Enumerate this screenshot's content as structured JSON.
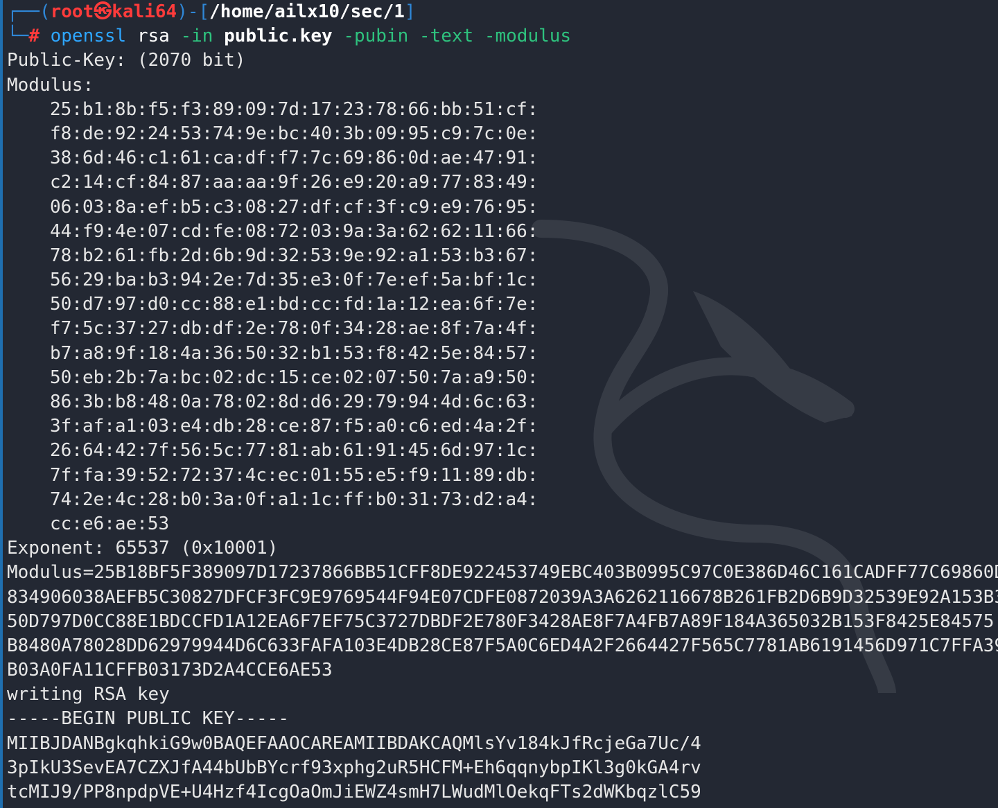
{
  "prompt": {
    "frame_top": "┌──(",
    "user": "root",
    "at_symbol": "㉿",
    "host": "kali64",
    "mid": ")-[",
    "cwd": "/home/ailx10/sec/1",
    "end": "]",
    "frame_bottom": "└─",
    "hash": "#"
  },
  "command": {
    "program": "openssl",
    "sub": "rsa",
    "flag_in": "-in",
    "file": "public.key",
    "flag_pubin": "-pubin",
    "flag_text": "-text",
    "flag_modulus": "-modulus"
  },
  "output": {
    "public_key_line": "Public-Key: (2070 bit)",
    "modulus_label": "Modulus:",
    "modulus_hex": [
      "25:b1:8b:f5:f3:89:09:7d:17:23:78:66:bb:51:cf:",
      "f8:de:92:24:53:74:9e:bc:40:3b:09:95:c9:7c:0e:",
      "38:6d:46:c1:61:ca:df:f7:7c:69:86:0d:ae:47:91:",
      "c2:14:cf:84:87:aa:aa:9f:26:e9:20:a9:77:83:49:",
      "06:03:8a:ef:b5:c3:08:27:df:cf:3f:c9:e9:76:95:",
      "44:f9:4e:07:cd:fe:08:72:03:9a:3a:62:62:11:66:",
      "78:b2:61:fb:2d:6b:9d:32:53:9e:92:a1:53:b3:67:",
      "56:29:ba:b3:94:2e:7d:35:e3:0f:7e:ef:5a:bf:1c:",
      "50:d7:97:d0:cc:88:e1:bd:cc:fd:1a:12:ea:6f:7e:",
      "f7:5c:37:27:db:df:2e:78:0f:34:28:ae:8f:7a:4f:",
      "b7:a8:9f:18:4a:36:50:32:b1:53:f8:42:5e:84:57:",
      "50:eb:2b:7a:bc:02:dc:15:ce:02:07:50:7a:a9:50:",
      "86:3b:b8:48:0a:78:02:8d:d6:29:79:94:4d:6c:63:",
      "3f:af:a1:03:e4:db:28:ce:87:f5:a0:c6:ed:4a:2f:",
      "26:64:42:7f:56:5c:77:81:ab:61:91:45:6d:97:1c:",
      "7f:fa:39:52:72:37:4c:ec:01:55:e5:f9:11:89:db:",
      "74:2e:4c:28:b0:3a:0f:a1:1c:ff:b0:31:73:d2:a4:",
      "cc:e6:ae:53"
    ],
    "exponent_line": "Exponent: 65537 (0x10001)",
    "modulus_eq_lines": [
      "Modulus=25B18BF5F389097D17237866BB51CFF8DE922453749EBC403B0995C97C0E386D46C161CADFF77C69860D",
      "834906038AEFB5C30827DFCF3FC9E9769544F94E07CDFE0872039A3A6262116678B261FB2D6B9D32539E92A153B3",
      "50D797D0CC88E1BDCCFD1A12EA6F7EF75C3727DBDF2E780F3428AE8F7A4FB7A89F184A365032B153F8425E84575",
      "B8480A78028DD62979944D6C633FAFA103E4DB28CE87F5A0C6ED4A2F2664427F565C7781AB6191456D971C7FFA39",
      "B03A0FA11CFFB03173D2A4CCE6AE53"
    ],
    "writing_line": "writing RSA key",
    "begin_line": "-----BEGIN PUBLIC KEY-----",
    "pem_lines": [
      "MIIBJDANBgkqhkiG9w0BAQEFAAOCAREAMIIBDAKCAQMlsYv184kJfRcjeGa7Uc/4",
      "3pIkU3SevEA7CZXJfA44bUbBYcrf93xphg2uR5HCFM+Eh6qqnybpIKl3g0kGA4rv",
      "tcMIJ9/PP8npdpVE+U4Hzf4IcgOaOmJiEWZ4smH7LWudMlOekqFTs2dWKbqzlC59"
    ]
  },
  "colors": {
    "background": "#232833",
    "prompt_frame": "#2f87d7",
    "prompt_user": "#ff3b3b",
    "command_program": "#2ea6ff",
    "command_flag": "#2ec27e",
    "output_text": "#e6e6e6"
  },
  "watermark_icon": "kali-dragon-icon"
}
